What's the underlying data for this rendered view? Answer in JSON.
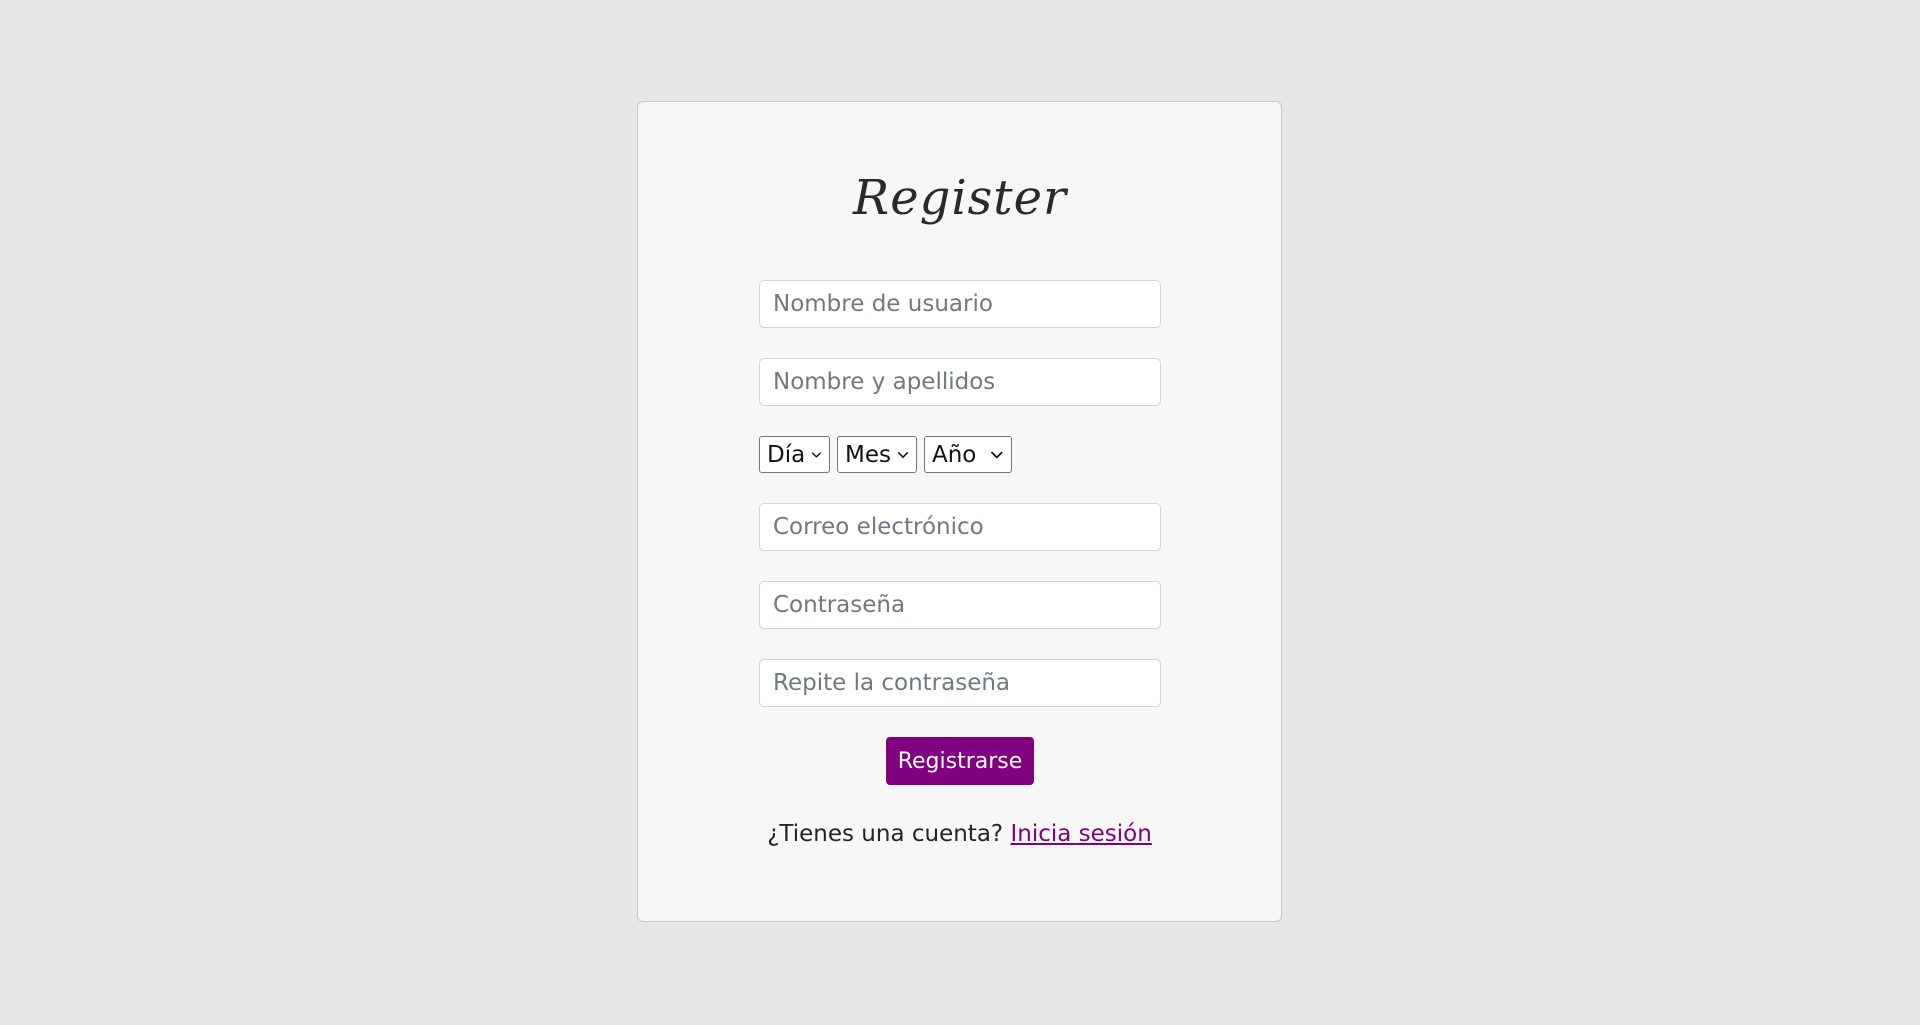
{
  "form": {
    "title": "Register",
    "fields": {
      "username": {
        "placeholder": "Nombre de usuario",
        "value": ""
      },
      "fullname": {
        "placeholder": "Nombre y apellidos",
        "value": ""
      },
      "email": {
        "placeholder": "Correo electrónico",
        "value": ""
      },
      "password": {
        "placeholder": "Contraseña",
        "value": ""
      },
      "password_repeat": {
        "placeholder": "Repite la contraseña",
        "value": ""
      }
    },
    "birthdate": {
      "day_label": "Día",
      "month_label": "Mes",
      "year_label": "Año"
    },
    "submit_label": "Registrarse",
    "login_prompt": "¿Tienes una cuenta?",
    "login_link": "Inicia sesión"
  },
  "colors": {
    "background": "#e7e7e7",
    "card": "#f7f7f7",
    "accent": "#800080"
  }
}
